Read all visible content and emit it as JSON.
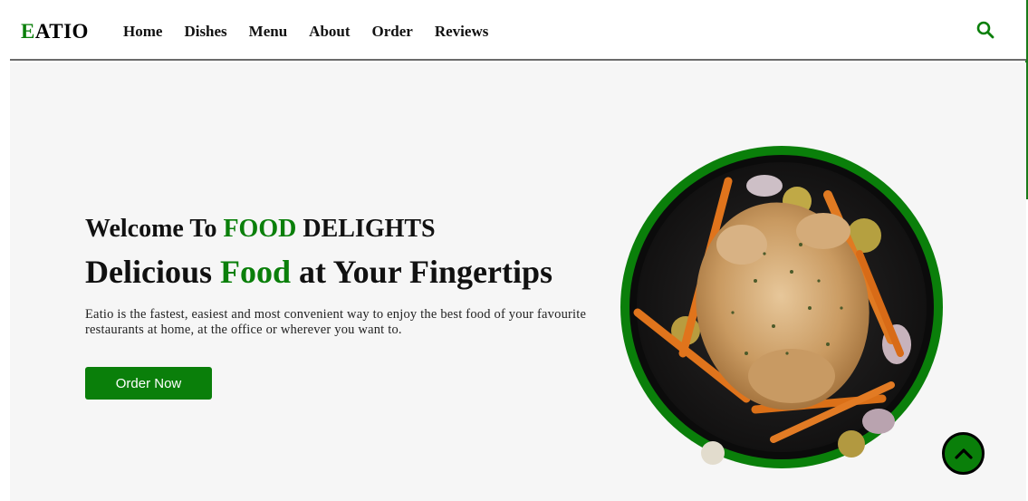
{
  "brand": {
    "logo_letter": "E",
    "logo_rest": "ATIO"
  },
  "nav": {
    "items": [
      {
        "label": "Home"
      },
      {
        "label": "Dishes"
      },
      {
        "label": "Menu"
      },
      {
        "label": "About"
      },
      {
        "label": "Order"
      },
      {
        "label": "Reviews"
      }
    ],
    "search_icon": "search-icon"
  },
  "hero": {
    "subtitle_prefix": "Welcome To",
    "subtitle_highlight": "FOOD",
    "subtitle_suffix": "DELIGHTS",
    "title_prefix": "Delicious",
    "title_highlight": "Food",
    "title_suffix": "at Your Fingertips",
    "description": "Eatio is the fastest, easiest and most convenient way to enjoy the best food of your favourite restaurants at home, at the office or wherever you want to.",
    "cta_label": "Order Now",
    "image": "roast-chicken-dish"
  },
  "colors": {
    "accent": "#0a7f0a",
    "text": "#111111",
    "hero_bg": "#f6f6f6"
  },
  "scroll_top_icon": "chevron-up-icon"
}
